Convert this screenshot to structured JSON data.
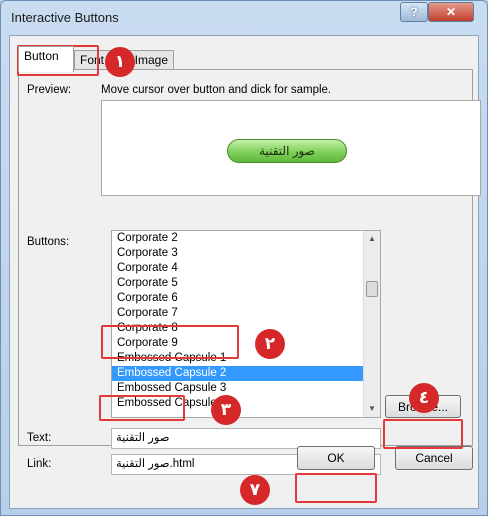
{
  "window": {
    "title": "Interactive Buttons",
    "help_label": "?",
    "close_label": "✕"
  },
  "tabs": [
    {
      "label": "Button"
    },
    {
      "label": "Font"
    },
    {
      "label": "Image"
    }
  ],
  "preview": {
    "label": "Preview:",
    "hint": "Move cursor over button and dick for sample.",
    "sample_button_text": "صور التقنية"
  },
  "buttons_list": {
    "label": "Buttons:",
    "items": [
      "Corporate 2",
      "Corporate 3",
      "Corporate 4",
      "Corporate 5",
      "Corporate 6",
      "Corporate 7",
      "Corporate 8",
      "Corporate 9",
      "Embossed Capsule 1",
      "Embossed Capsule 2",
      "Embossed Capsule 3",
      "Embossed Capsule 4"
    ],
    "selected": "Embossed Capsule 2"
  },
  "text_field": {
    "label": "Text:",
    "value": "صور التقنية"
  },
  "link_field": {
    "label": "Link:",
    "value": "صور التقنية.html"
  },
  "browse_label": "Browse...",
  "ok_label": "OK",
  "cancel_label": "Cancel",
  "annotation_badges": [
    "١",
    "٢",
    "٣",
    "٤",
    "٧"
  ],
  "colors": {
    "annotation": "#d62828",
    "selection": "#3399ff",
    "sample_button": "#7fd05a"
  }
}
